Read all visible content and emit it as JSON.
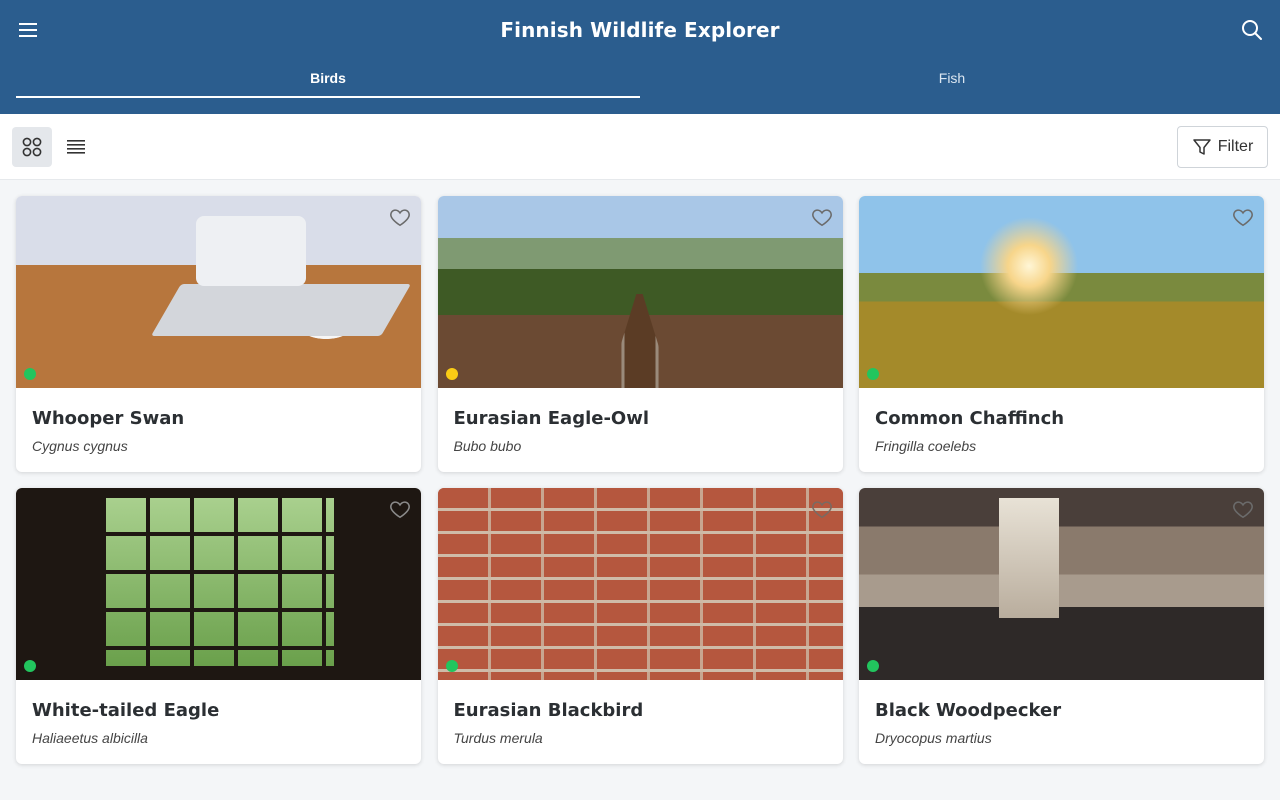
{
  "header": {
    "title": "Finnish Wildlife Explorer",
    "menu_icon": "menu-icon",
    "search_icon": "search-icon",
    "background_color": "#2b5d8e"
  },
  "tabs": [
    {
      "label": "Birds",
      "active": true
    },
    {
      "label": "Fish",
      "active": false
    }
  ],
  "toolbar": {
    "grid_view_icon": "grid-view-icon",
    "list_view_icon": "list-view-icon",
    "active_view": "grid",
    "filter_label": "Filter",
    "filter_icon": "filter-icon"
  },
  "status_colors": {
    "green": "#22c55e",
    "yellow": "#facc15"
  },
  "cards": [
    {
      "name": "Whooper Swan",
      "scientific": "Cygnus cygnus",
      "status": "green",
      "favorite": false
    },
    {
      "name": "Eurasian Eagle-Owl",
      "scientific": "Bubo bubo",
      "status": "yellow",
      "favorite": false
    },
    {
      "name": "Common Chaffinch",
      "scientific": "Fringilla coelebs",
      "status": "green",
      "favorite": false
    },
    {
      "name": "White-tailed Eagle",
      "scientific": "Haliaeetus albicilla",
      "status": "green",
      "favorite": false
    },
    {
      "name": "Eurasian Blackbird",
      "scientific": "Turdus merula",
      "status": "green",
      "favorite": false
    },
    {
      "name": "Black Woodpecker",
      "scientific": "Dryocopus martius",
      "status": "green",
      "favorite": false
    }
  ]
}
